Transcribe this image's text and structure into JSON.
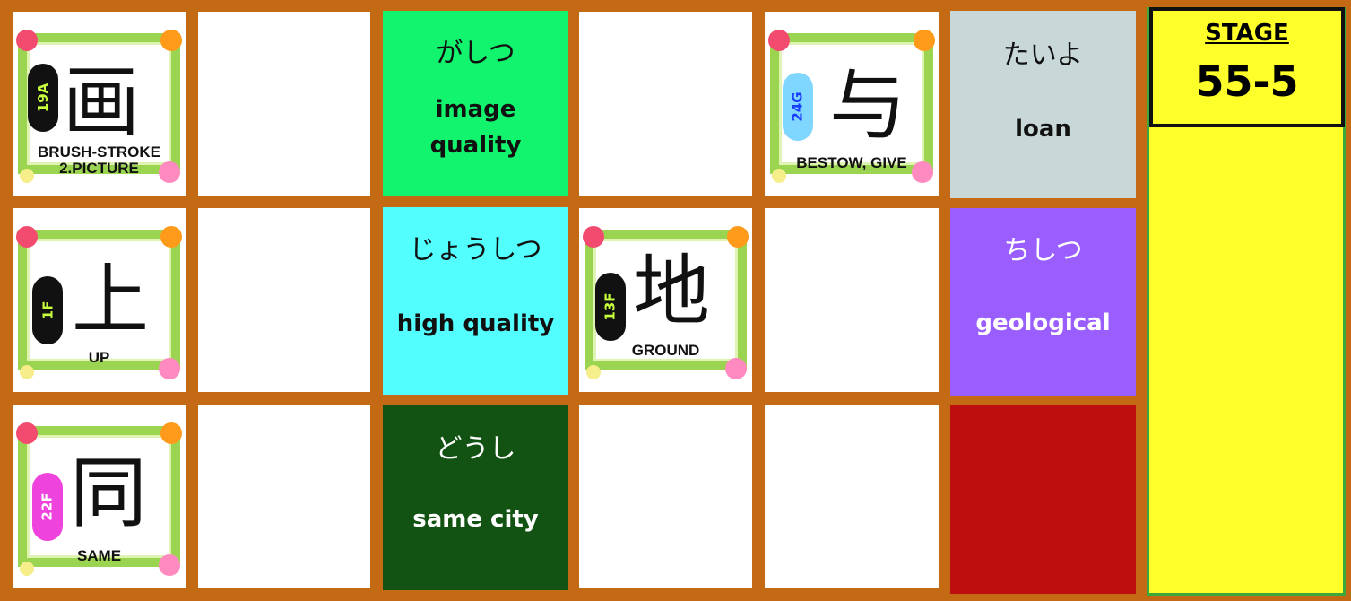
{
  "stage": {
    "label": "STAGE",
    "value": "55-5"
  },
  "kanji_cards": [
    {
      "kanji": "画",
      "code": "19A",
      "meaning1": "BRUSH-STROKE",
      "meaning2": "2.PICTURE",
      "badge_color": "#111111",
      "code_color": "#c8ff3c"
    },
    {
      "kanji": "上",
      "code": "1F",
      "meaning1": "UP",
      "meaning2": "",
      "badge_color": "#111111",
      "code_color": "#c8ff3c"
    },
    {
      "kanji": "同",
      "code": "22F",
      "meaning1": "SAME",
      "meaning2": "",
      "badge_color": "#ee44dd",
      "code_color": "#ffffff"
    },
    {
      "kanji": "地",
      "code": "13F",
      "meaning1": "GROUND",
      "meaning2": "",
      "badge_color": "#111111",
      "code_color": "#c8ff3c"
    },
    {
      "kanji": "与",
      "code": "24G",
      "meaning1": "BESTOW, GIVE",
      "meaning2": "",
      "badge_color": "#7fd6ff",
      "code_color": "#1a3cff"
    }
  ],
  "word_tiles": [
    {
      "kana": "がしつ",
      "english": "image quality",
      "bg": "#12f46e",
      "color": "#111111"
    },
    {
      "kana": "じょうしつ",
      "english": "high quality",
      "bg": "#52fefe",
      "color": "#111111"
    },
    {
      "kana": "どうし",
      "english": "same city",
      "bg": "#125212",
      "color": "#ffffff"
    },
    {
      "kana": "たいよ",
      "english": "loan",
      "bg": "#c8d8d8",
      "color": "#111111"
    },
    {
      "kana": "ちしつ",
      "english": "geological",
      "bg": "#9a5efe",
      "color": "#ffffff"
    }
  ],
  "colors": {
    "board": "#c46a14",
    "stage_bg": "#fefe2a",
    "red_tile": "#be0e0e"
  }
}
